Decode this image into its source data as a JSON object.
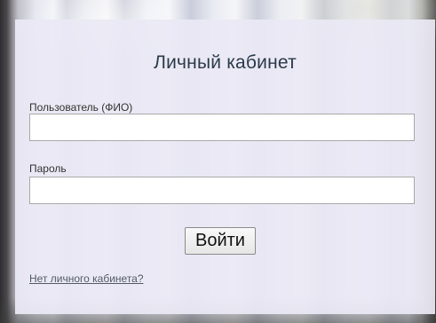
{
  "login": {
    "title": "Личный кабинет",
    "user_label": "Пользователь (ФИО)",
    "user_value": "",
    "password_label": "Пароль",
    "password_value": "",
    "submit_label": "Войти",
    "no_account_link": "Нет личного кабинета?"
  },
  "colors": {
    "panel_bg": "#e9e8f4",
    "title_text": "#2b3a4a",
    "link_text": "#555c66"
  }
}
